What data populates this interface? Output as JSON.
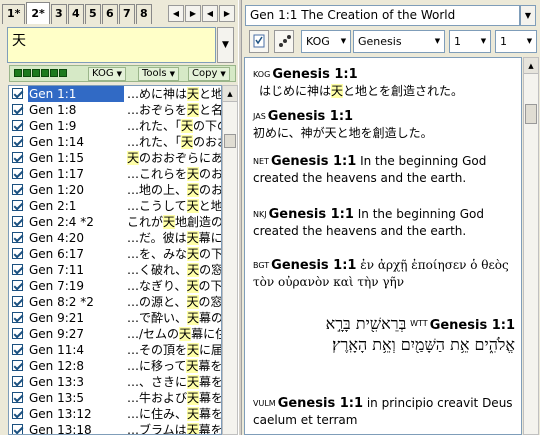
{
  "tabs": [
    "1*",
    "2*",
    "3",
    "4",
    "5",
    "6",
    "7",
    "8"
  ],
  "search": {
    "value": "天"
  },
  "left_toolbar": {
    "version_btn": "KOG",
    "tools_btn": "Tools",
    "copy_btn": "Copy"
  },
  "results": [
    {
      "ref": "Gen 1:1",
      "pre": "…めに神は",
      "hl": "天",
      "post": "と地",
      "selected": true
    },
    {
      "ref": "Gen 1:8",
      "pre": "…おぞらを",
      "hl": "天",
      "post": "と名づ",
      "selected": false
    },
    {
      "ref": "Gen 1:9",
      "pre": "…れた、「",
      "hl": "天",
      "post": "の下の",
      "selected": false
    },
    {
      "ref": "Gen 1:14",
      "pre": "…れた、「",
      "hl": "天",
      "post": "のおお",
      "selected": false
    },
    {
      "ref": "Gen 1:15",
      "pre": "",
      "hl": "天",
      "post": "のおおぞらにあ",
      "selected": false
    },
    {
      "ref": "Gen 1:17",
      "pre": "…これらを",
      "hl": "天",
      "post": "のおお",
      "selected": false
    },
    {
      "ref": "Gen 1:20",
      "pre": "…地の上、",
      "hl": "天",
      "post": "のおお",
      "selected": false
    },
    {
      "ref": "Gen 2:1",
      "pre": "…こうして",
      "hl": "天",
      "post": "と地と",
      "selected": false
    },
    {
      "ref": "Gen 2:4 *2",
      "pre": "これが",
      "hl": "天",
      "post": "地創造の",
      "selected": false
    },
    {
      "ref": "Gen 4:20",
      "pre": "…だ。彼は",
      "hl": "天",
      "post": "幕に",
      "selected": false
    },
    {
      "ref": "Gen 6:17",
      "pre": "…を、みな",
      "hl": "天",
      "post": "の下か",
      "selected": false
    },
    {
      "ref": "Gen 7:11",
      "pre": "…く破れ、",
      "hl": "天",
      "post": "の窓が",
      "selected": false
    },
    {
      "ref": "Gen 7:19",
      "pre": "…なぎり、",
      "hl": "天",
      "post": "の下に",
      "selected": false
    },
    {
      "ref": "Gen 8:2 *2",
      "pre": "…の源と、",
      "hl": "天",
      "post": "の窓と",
      "selected": false
    },
    {
      "ref": "Gen 9:21",
      "pre": "…で酔い、",
      "hl": "天",
      "post": "幕の中",
      "selected": false
    },
    {
      "ref": "Gen 9:27",
      "pre": "…/セムの",
      "hl": "天",
      "post": "幕に住",
      "selected": false
    },
    {
      "ref": "Gen 11:4",
      "pre": "…その頂を",
      "hl": "天",
      "post": "に届か",
      "selected": false
    },
    {
      "ref": "Gen 12:8",
      "pre": "…に移って",
      "hl": "天",
      "post": "幕を張",
      "selected": false
    },
    {
      "ref": "Gen 13:3",
      "pre": "…、さきに",
      "hl": "天",
      "post": "幕を張",
      "selected": false
    },
    {
      "ref": "Gen 13:5",
      "pre": "…牛および",
      "hl": "天",
      "post": "幕を持",
      "selected": false
    },
    {
      "ref": "Gen 13:12",
      "pre": "…に住み、",
      "hl": "天",
      "post": "幕をソ",
      "selected": false
    },
    {
      "ref": "Gen 13:18",
      "pre": "…ブラムは",
      "hl": "天",
      "post": "幕を移",
      "selected": false
    }
  ],
  "right": {
    "title": "Gen 1:1 The Creation of the World",
    "version_combo": "KOG",
    "book_combo": "Genesis",
    "chapter_combo": "1",
    "verse_combo": "1"
  },
  "verses": [
    {
      "abbr": "KOG",
      "ref": "Genesis 1:1",
      "pre": "はじめに神は",
      "hl": "天",
      "post": "と地とを創造された。"
    },
    {
      "abbr": "JAS",
      "ref": "Genesis 1:1",
      "text": "初めに、神が天と地を創造した。"
    },
    {
      "abbr": "NET",
      "ref": "Genesis 1:1",
      "text": "In the beginning God created the heavens and the earth."
    },
    {
      "abbr": "NKJ",
      "ref": "Genesis 1:1",
      "text": "In the beginning God created the heavens and the earth."
    },
    {
      "abbr": "BGT",
      "ref": "Genesis 1:1",
      "text": "ἐν ἀρχῇ ἐποίησεν ὁ θεὸς τὸν οὐρανὸν καὶ τὴν γῆν"
    },
    {
      "abbr": "WTT",
      "ref": "Genesis 1:1",
      "heb1": "בְּרֵאשִׁ֖ית בָּרָ֣א",
      "heb2": "אֱלֹהִ֑ים אֵ֥ת הַשָּׁמַ֖יִם וְאֵ֥ת הָאָֽרֶץ׃"
    },
    {
      "abbr": "VULM",
      "ref": "Genesis 1:1",
      "text": "in principio creavit Deus caelum et terram"
    }
  ]
}
